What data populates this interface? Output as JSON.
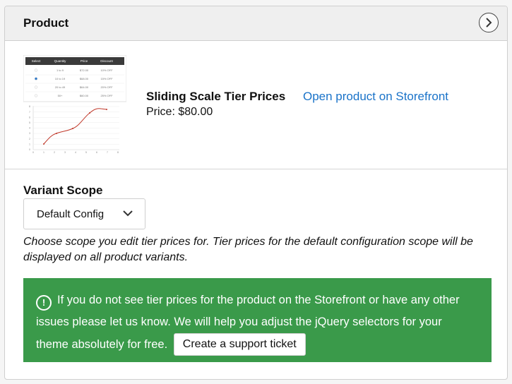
{
  "header": {
    "title": "Product",
    "expand_icon": "chevron-right-icon"
  },
  "product": {
    "name": "Sliding Scale Tier Prices",
    "storefront_link": "Open product on Storefront",
    "price": "Price: $80.00",
    "thumbnail": {
      "table_headers": [
        "Select",
        "Quantity",
        "Price",
        "Discount"
      ],
      "table_rows": [
        [
          "1 to 9",
          "$72.00",
          "10% OFF"
        ],
        [
          "10 to 19",
          "$68.00",
          "15% OFF"
        ],
        [
          "20 to 49",
          "$64.00",
          "20% OFF"
        ],
        [
          "50+",
          "$60.00",
          "25% OFF"
        ]
      ],
      "chart_y_ticks": [
        "8",
        "7",
        "6",
        "5",
        "4",
        "3",
        "2",
        "1",
        "0"
      ],
      "chart_x_ticks": [
        "0",
        "1",
        "2",
        "3",
        "4",
        "5",
        "6",
        "7",
        "8"
      ],
      "curve_color": "#c0392b"
    }
  },
  "variant_scope": {
    "label": "Variant Scope",
    "selected": "Default Config",
    "hint": "Choose scope you edit tier prices for. Tier prices for the default configuration scope will be displayed on all product variants."
  },
  "alert": {
    "icon": "exclamation-icon",
    "message": "If you do not see tier prices for the product on the Storefront or have any other issues please let us know. We will help you adjust the jQuery selectors for your theme absolutely for free.",
    "button": "Create a support ticket",
    "background": "#3a9a4a"
  }
}
